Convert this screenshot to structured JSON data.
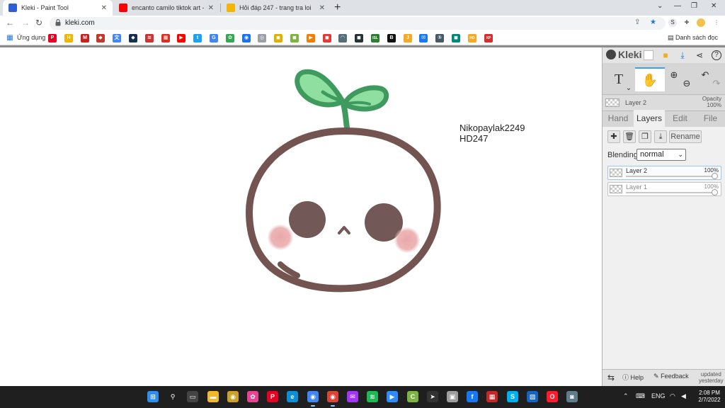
{
  "browser": {
    "tabs": [
      {
        "title": "Kleki - Paint Tool",
        "active": true,
        "color": "#2f5fd6"
      },
      {
        "title": "encanto camilo tiktok art - YouTube",
        "active": false,
        "color": "#ff0000"
      },
      {
        "title": "Hỏi đáp 247 - trang tra loi",
        "active": false,
        "color": "#f4b400"
      }
    ],
    "url": "kleki.com",
    "bookmarks_apps_label": "Ứng dụng",
    "bookmark_icons": [
      {
        "name": "pinterest",
        "color": "#e60023",
        "glyph": "P"
      },
      {
        "name": "hoidap",
        "color": "#f4b400",
        "glyph": "H"
      },
      {
        "name": "gmail",
        "color": "#c5221f",
        "glyph": "M"
      },
      {
        "name": "shield",
        "color": "#c0392b",
        "glyph": "◆"
      },
      {
        "name": "translate",
        "color": "#4285f4",
        "glyph": "文"
      },
      {
        "name": "app-dark",
        "color": "#17304d",
        "glyph": "◆"
      },
      {
        "name": "drawing",
        "color": "#cc3333",
        "glyph": "≋"
      },
      {
        "name": "grid-red",
        "color": "#d93025",
        "glyph": "▦"
      },
      {
        "name": "youtube",
        "color": "#ff0000",
        "glyph": "▶"
      },
      {
        "name": "twitter",
        "color": "#1da1f2",
        "glyph": "t"
      },
      {
        "name": "google",
        "color": "#4285f4",
        "glyph": "G"
      },
      {
        "name": "colorful",
        "color": "#34a853",
        "glyph": "✿"
      },
      {
        "name": "chrome-web",
        "color": "#1a73e8",
        "glyph": "◉"
      },
      {
        "name": "circle-app",
        "color": "#9aa0a6",
        "glyph": "◎"
      },
      {
        "name": "yellow-app",
        "color": "#e0b000",
        "glyph": "◼"
      },
      {
        "name": "green-app",
        "color": "#7cb342",
        "glyph": "◼"
      },
      {
        "name": "orange-app",
        "color": "#f57c00",
        "glyph": "▶"
      },
      {
        "name": "red-app",
        "color": "#e53935",
        "glyph": "◼"
      },
      {
        "name": "headset",
        "color": "#546e7a",
        "glyph": "◠"
      },
      {
        "name": "dark-app",
        "color": "#263238",
        "glyph": "◼"
      },
      {
        "name": "isl",
        "color": "#2e7d32",
        "glyph": "ISL"
      },
      {
        "name": "b-app",
        "color": "#111111",
        "glyph": "B"
      },
      {
        "name": "j-app",
        "color": "#f9a825",
        "glyph": "J"
      },
      {
        "name": "messenger",
        "color": "#1877f2",
        "glyph": "✉"
      },
      {
        "name": "num-app",
        "color": "#455a64",
        "glyph": "①"
      },
      {
        "name": "teal-app",
        "color": "#00897b",
        "glyph": "◼"
      },
      {
        "name": "hd-app",
        "color": "#f9a825",
        "glyph": "HD"
      },
      {
        "name": "xp-app",
        "color": "#d32f2f",
        "glyph": "XP"
      }
    ],
    "reading_list": "Danh sách đọc"
  },
  "canvas": {
    "text_lines": [
      "Nikopaylak2249",
      "HD247"
    ],
    "colors": {
      "outline": "#735451",
      "eye": "#725856",
      "blush": "#e8a3a6",
      "leaf": "#8fe0a0",
      "leaf_outline": "#3f9a5f"
    }
  },
  "kleki": {
    "logo": "Kleki",
    "layer_name": "Layer 2",
    "opacity_label": "Opacity",
    "opacity_value": "100%",
    "tabs": [
      "Hand",
      "Layers",
      "Edit",
      "File"
    ],
    "active_tab": "Layers",
    "rename_label": "Rename",
    "blending_label": "Blending",
    "blending_value": "normal",
    "layers": [
      {
        "name": "Layer 2",
        "opacity": "100%",
        "selected": true,
        "opacity_fraction": 1.0
      },
      {
        "name": "Layer 1",
        "opacity": "100%",
        "selected": false,
        "opacity_fraction": 1.0
      }
    ],
    "footer": {
      "help": "Help",
      "feedback": "Feedback",
      "updated_line1": "updated",
      "updated_line2": "yesterday"
    },
    "accent": "#3aa3e3"
  },
  "taskbar": {
    "apps": [
      {
        "name": "start",
        "color": "#2f8cf0",
        "glyph": "⊞"
      },
      {
        "name": "search",
        "color": "#1f1f1f",
        "glyph": "⚲"
      },
      {
        "name": "task-view",
        "color": "#444444",
        "glyph": "▭"
      },
      {
        "name": "file-explorer",
        "color": "#f2b82c",
        "glyph": "▬"
      },
      {
        "name": "app-gold",
        "color": "#c9a227",
        "glyph": "◉"
      },
      {
        "name": "app-colorful",
        "color": "#e84393",
        "glyph": "✿"
      },
      {
        "name": "pinterest",
        "color": "#e60023",
        "glyph": "P"
      },
      {
        "name": "edge",
        "color": "#0c8fd8",
        "glyph": "e"
      },
      {
        "name": "chrome",
        "color": "#4285f4",
        "glyph": "◉"
      },
      {
        "name": "chrome-2",
        "color": "#db4437",
        "glyph": "◉"
      },
      {
        "name": "messenger",
        "color": "#a334fa",
        "glyph": "✉"
      },
      {
        "name": "spotify",
        "color": "#1db954",
        "glyph": "≋"
      },
      {
        "name": "zoom",
        "color": "#2d8cff",
        "glyph": "▶"
      },
      {
        "name": "ccleaner",
        "color": "#7cb342",
        "glyph": "C"
      },
      {
        "name": "cursor-app",
        "color": "#333333",
        "glyph": "➤"
      },
      {
        "name": "photo-app",
        "color": "#9e9e9e",
        "glyph": "▣"
      },
      {
        "name": "facebook",
        "color": "#1877f2",
        "glyph": "f"
      },
      {
        "name": "app-red",
        "color": "#c62828",
        "glyph": "▦"
      },
      {
        "name": "skype",
        "color": "#00aff0",
        "glyph": "S"
      },
      {
        "name": "photos",
        "color": "#1565c0",
        "glyph": "▨"
      },
      {
        "name": "opera",
        "color": "#ff1b2d",
        "glyph": "O"
      },
      {
        "name": "camera",
        "color": "#607d8b",
        "glyph": "◙"
      }
    ],
    "language": "ENG",
    "time": "2:08 PM",
    "date": "2/7/2022"
  }
}
